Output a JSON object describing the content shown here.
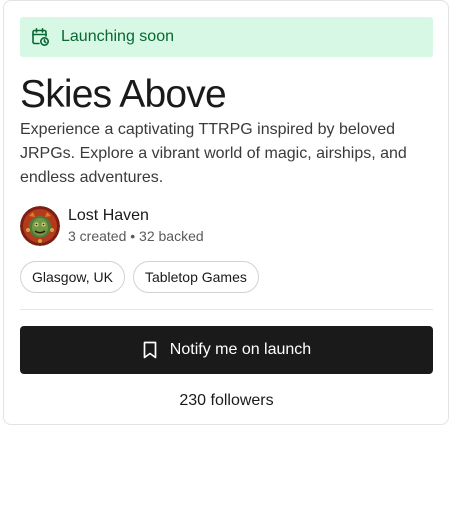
{
  "status_banner": {
    "text": "Launching soon",
    "icon": "calendar-clock-icon",
    "background_color": "#d6f8e5",
    "text_color": "#086733"
  },
  "project": {
    "title": "Skies Above",
    "description": "Experience a captivating TTRPG inspired by beloved JRPGs. Explore a vibrant world of magic, airships, and endless adventures."
  },
  "creator": {
    "name": "Lost Haven",
    "stats": "3 created • 32 backed",
    "avatar_icon": "creator-avatar"
  },
  "tags": [
    {
      "label": "Glasgow, UK"
    },
    {
      "label": "Tabletop Games"
    }
  ],
  "actions": {
    "notify_label": "Notify me on launch",
    "notify_icon": "bookmark-icon",
    "button_color": "#1a1a1a"
  },
  "followers": {
    "text": "230 followers"
  }
}
